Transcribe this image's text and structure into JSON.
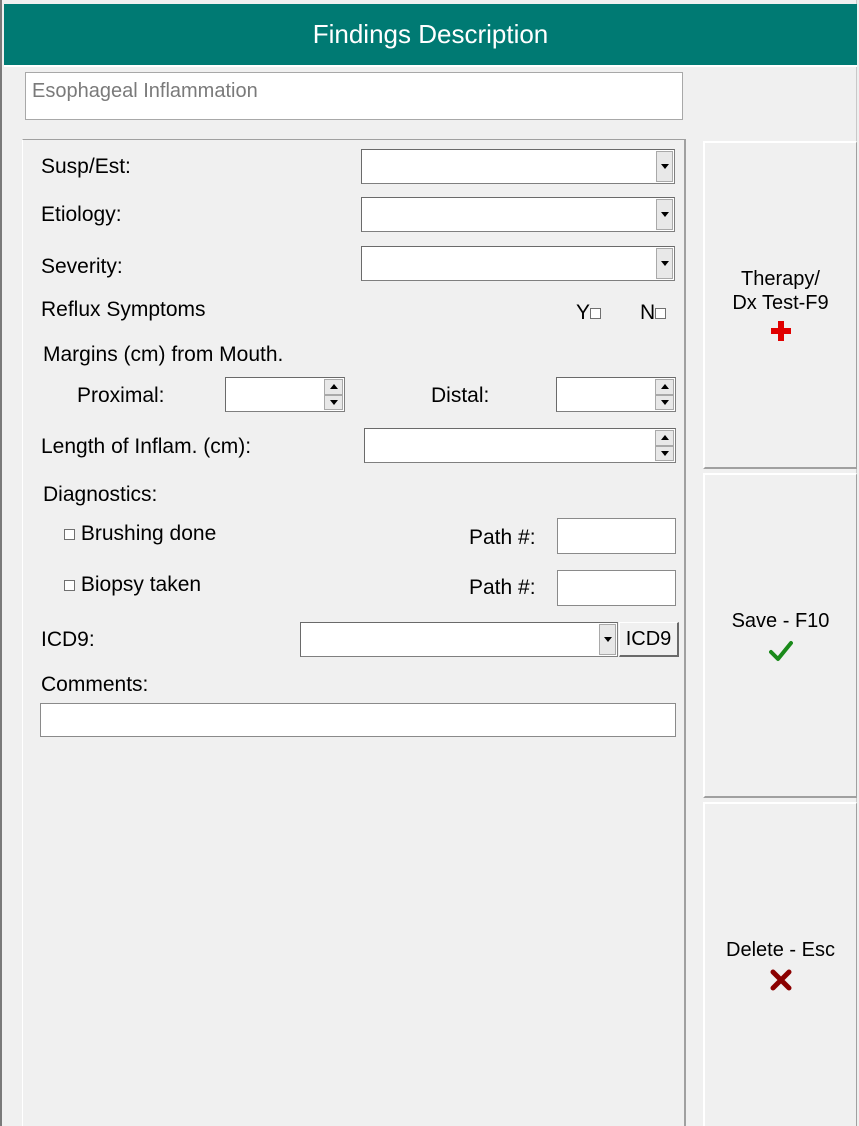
{
  "header": {
    "title": "Findings Description"
  },
  "finding": {
    "name": "Esophageal Inflammation"
  },
  "form": {
    "susp_est_label": "Susp/Est:",
    "etiology_label": "Etiology:",
    "severity_label": "Severity:",
    "reflux_label": "Reflux Symptoms",
    "reflux_yes": "Y",
    "reflux_no": "N",
    "margins_label": "Margins (cm) from Mouth.",
    "proximal_label": "Proximal:",
    "distal_label": "Distal:",
    "length_label": "Length of Inflam. (cm):",
    "diagnostics_label": "Diagnostics:",
    "brushing_label": "Brushing done",
    "biopsy_label": "Biopsy taken",
    "path1_label": "Path #:",
    "path2_label": "Path #:",
    "icd9_label": "ICD9:",
    "icd9_button": "ICD9",
    "comments_label": "Comments:"
  },
  "side_buttons": {
    "therapy_line1": "Therapy/",
    "therapy_line2": "Dx Test-F9",
    "save": "Save - F10",
    "delete": "Delete - Esc"
  },
  "icons": {
    "therapy": "red-cross-icon",
    "save": "green-check-icon",
    "delete": "red-x-icon"
  },
  "colors": {
    "title_bar": "#007a73",
    "cross": "#e00000",
    "check": "#1a8a1a",
    "x_mark": "#8b0000"
  }
}
